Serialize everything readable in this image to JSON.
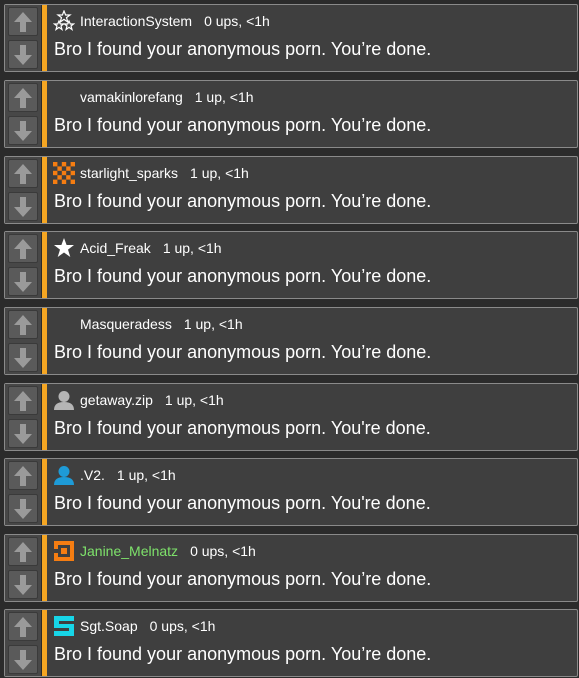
{
  "comments": [
    {
      "username": "InteractionSystem",
      "score_text": "0 ups, <1h",
      "message": "Bro I found your anonymous porn. You’re done.",
      "avatar": "stars-icon"
    },
    {
      "username": "vamakinlorefang",
      "score_text": "1 up, <1h",
      "message": "Bro I found your anonymous porn. You’re done.",
      "avatar": "none"
    },
    {
      "username": "starlight_sparks",
      "score_text": "1 up, <1h",
      "message": "Bro I found your anonymous porn. You’re done.",
      "avatar": "checker-icon"
    },
    {
      "username": "Acid_Freak",
      "score_text": "1 up, <1h",
      "message": "Bro I found your anonymous porn. You’re done.",
      "avatar": "star-icon"
    },
    {
      "username": "Masqueradess",
      "score_text": "1 up, <1h",
      "message": "Bro I found your anonymous porn. You’re done.",
      "avatar": "none"
    },
    {
      "username": "getaway.zip",
      "score_text": "1 up, <1h",
      "message": "Bro I found your anonymous porn. You're done.",
      "avatar": "default-user-icon"
    },
    {
      "username": ".V2.",
      "score_text": "1 up, <1h",
      "message": "Bro I found your anonymous porn. You're done.",
      "avatar": "blue-user-icon"
    },
    {
      "username": "Janine_Melnatz",
      "score_text": "0 ups, <1h",
      "message": "Bro I found your anonymous porn. You’re done.",
      "avatar": "orange-square-icon"
    },
    {
      "username": "Sgt.Soap",
      "score_text": "0 ups, <1h",
      "message": "Bro I found your anonymous porn. You’re done.",
      "avatar": "cyan-s-icon"
    }
  ],
  "colors": {
    "accent": "#f5a623",
    "card_bg": "#3f3f3f",
    "green_username": "#7ee26b",
    "blue_avatar": "#1e9bd7",
    "cyan_avatar": "#17d6e8",
    "orange_avatar": "#f57d12"
  }
}
